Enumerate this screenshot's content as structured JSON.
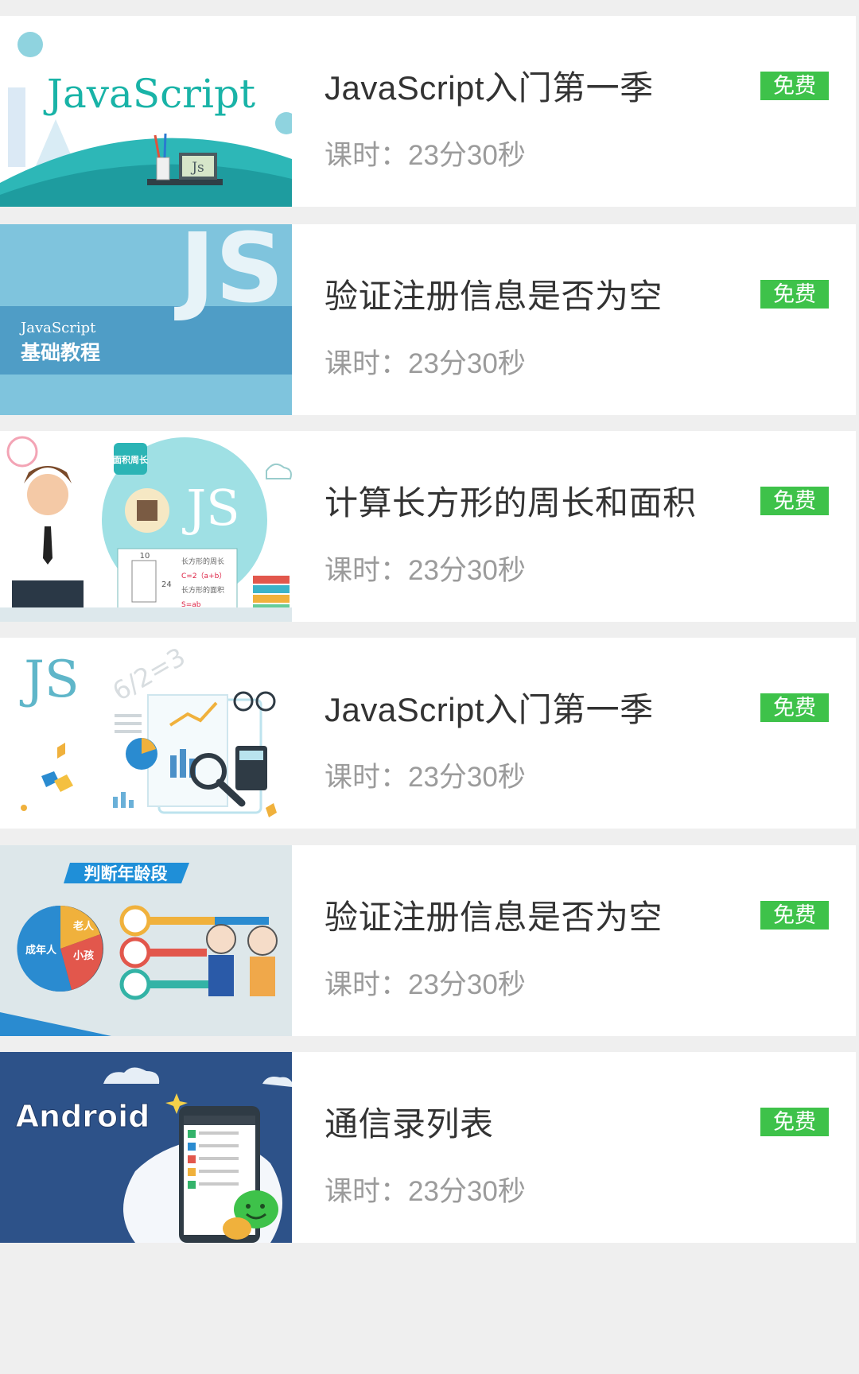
{
  "courses": [
    {
      "thumbnail": "javascript-illustration",
      "thumb_text": "JavaScript",
      "thumb_badge": "Js",
      "title": "JavaScript入门第一季",
      "duration": "课时：23分30秒",
      "badge": "免费"
    },
    {
      "thumbnail": "js-basic-tutorial",
      "thumb_big": "JS",
      "thumb_line1": "JavaScript",
      "thumb_line2": "基础教程",
      "title": "验证注册信息是否为空",
      "duration": "课时：23分30秒",
      "badge": "免费"
    },
    {
      "thumbnail": "rectangle-area-perimeter",
      "thumb_tag": "面积周长",
      "thumb_big": "JS",
      "thumb_w": "10",
      "thumb_h": "24",
      "thumb_f1": "长方形的周长",
      "thumb_f2": "C=2（a+b）",
      "thumb_f3": "长方形的面积",
      "thumb_f4": "S=ab",
      "title": "计算长方形的周长和面积",
      "duration": "课时：23分30秒",
      "badge": "免费"
    },
    {
      "thumbnail": "js-charts-magnifier",
      "thumb_big": "JS",
      "thumb_eq": "6/2=3",
      "title": "JavaScript入门第一季",
      "duration": "课时：23分30秒",
      "badge": "免费"
    },
    {
      "thumbnail": "judge-age-group",
      "thumb_title": "判断年龄段",
      "thumb_p1": "老人",
      "thumb_p2": "成年人",
      "thumb_p3": "小孩",
      "title": "验证注册信息是否为空",
      "duration": "课时：23分30秒",
      "badge": "免费"
    },
    {
      "thumbnail": "android-contacts",
      "thumb_text": "Android",
      "title": "通信录列表",
      "duration": "课时：23分30秒",
      "badge": "免费"
    }
  ],
  "colors": {
    "badge": "#3ec24a",
    "title": "#333333",
    "duration": "#9b9b9b",
    "background": "#efefef"
  }
}
